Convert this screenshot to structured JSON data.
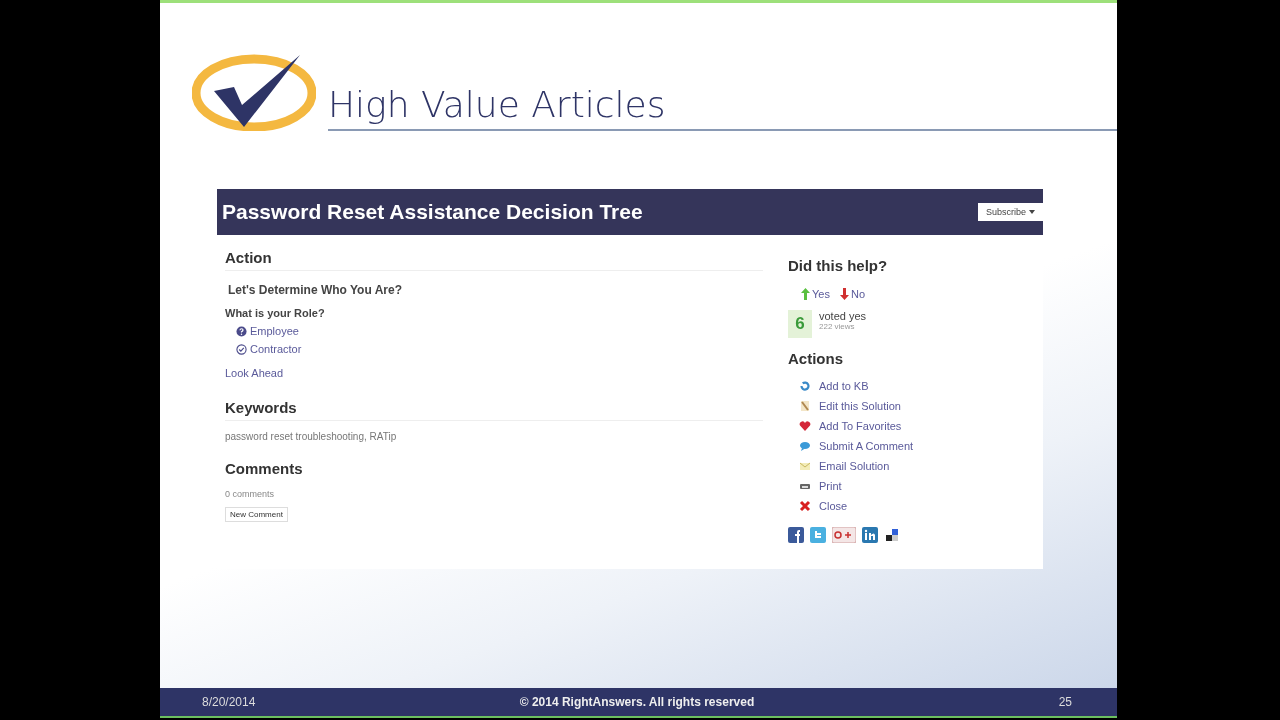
{
  "slide": {
    "title": "High Value Articles",
    "footer": {
      "date": "8/20/2014",
      "copyright": "© 2014 RightAnswers. All rights reserved",
      "page": "25"
    }
  },
  "article": {
    "title": "Password Reset Assistance Decision Tree",
    "subscribe": "Subscribe",
    "action": {
      "heading": "Action",
      "question_title": "Let's Determine Who You Are?",
      "prompt": "What is your Role?",
      "options": [
        {
          "label": "Employee",
          "kind": "question"
        },
        {
          "label": "Contractor",
          "kind": "check"
        }
      ],
      "look_ahead": "Look Ahead"
    },
    "keywords": {
      "heading": "Keywords",
      "text": "password reset troubleshooting, RATip"
    },
    "comments": {
      "heading": "Comments",
      "count": "0 comments",
      "button": "New Comment"
    },
    "feedback": {
      "heading": "Did this help?",
      "yes": "Yes",
      "no": "No",
      "score": "6",
      "score_label": "voted yes",
      "views": "222 views"
    },
    "actions": {
      "heading": "Actions",
      "items": [
        {
          "label": "Add to KB",
          "kind": "add"
        },
        {
          "label": "Edit this Solution",
          "kind": "edit"
        },
        {
          "label": "Add To Favorites",
          "kind": "favorite"
        },
        {
          "label": "Submit A Comment",
          "kind": "comment"
        },
        {
          "label": "Email Solution",
          "kind": "email"
        },
        {
          "label": "Print",
          "kind": "print"
        },
        {
          "label": "Close",
          "kind": "close"
        }
      ]
    },
    "share": [
      {
        "kind": "facebook"
      },
      {
        "kind": "twitter"
      },
      {
        "kind": "gplus"
      },
      {
        "kind": "linkedin"
      },
      {
        "kind": "delicious"
      }
    ]
  }
}
